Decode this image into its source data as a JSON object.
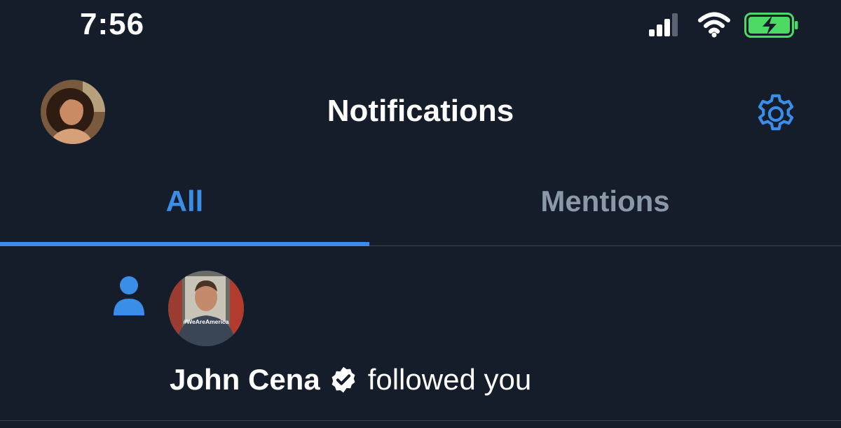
{
  "status_bar": {
    "time": "7:56",
    "signal_icon": "cellular-signal-icon",
    "wifi_icon": "wifi-icon",
    "battery_icon": "battery-charging-icon",
    "battery_color": "#4cd964"
  },
  "header": {
    "title": "Notifications",
    "avatar_icon": "user-avatar",
    "settings_icon": "gear-icon"
  },
  "tabs": [
    {
      "label": "All",
      "active": true
    },
    {
      "label": "Mentions",
      "active": false
    }
  ],
  "notifications": [
    {
      "type_icon": "person-icon",
      "user_name": "John Cena",
      "verified": true,
      "action": "followed you",
      "avatar_caption": "#WeAreAmerica"
    }
  ],
  "colors": {
    "background": "#151d2b",
    "accent": "#3b8ee8",
    "inactive_tab": "#8a98a8",
    "divider": "#38444d"
  }
}
